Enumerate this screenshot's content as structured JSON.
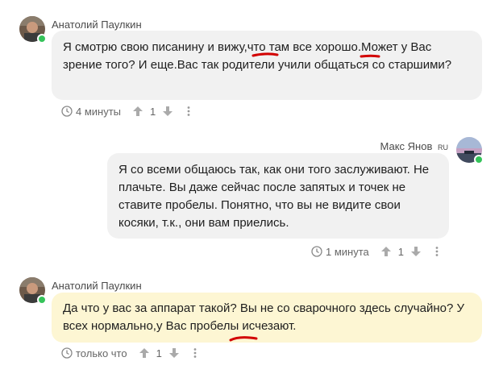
{
  "comments": [
    {
      "author": "Анатолий Паулкин",
      "text": "Я смотрю свою писанину и вижу,что там все хорошо.Может у Вас зрение того? И еще.Вас так родители учили общаться со старшими?",
      "time": "4 минуты",
      "votes": "1"
    },
    {
      "author": "Макс Янов",
      "author_badge": "RU",
      "text": "Я со всеми общаюсь так, как они того заслуживают. Не плачьте. Вы даже сейчас после запятых и точек не ставите пробелы. Понятно, что вы не видите свои косяки, т.к., они вам приелись.",
      "time": "1 минута",
      "votes": "1"
    },
    {
      "author": "Анатолий Паулкин",
      "text": "Да что у вас за аппарат такой? Вы не со сварочного здесь случайно? У всех нормально,у Вас пробелы исчезают.",
      "time": "только что",
      "votes": "1"
    }
  ],
  "icons": {
    "clock": "clock-icon",
    "upvote": "arrow-up-icon",
    "downvote": "arrow-down-icon",
    "more": "more-vertical-icon"
  },
  "colors": {
    "bubble_grey": "#f1f1f1",
    "bubble_highlight": "#fdf6d3",
    "online": "#35c35a",
    "annotation": "#d20000"
  }
}
